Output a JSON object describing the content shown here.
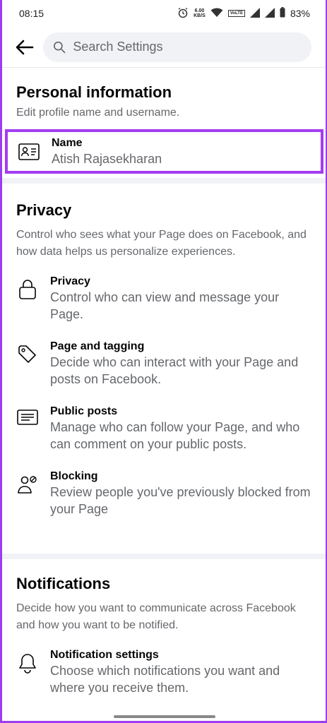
{
  "status_bar": {
    "time": "08:15",
    "net_speed_value": "6.00",
    "net_speed_unit": "KB/S",
    "volte": "VoLTE",
    "battery": "83%"
  },
  "header": {
    "search_placeholder": "Search Settings"
  },
  "personal": {
    "title": "Personal information",
    "desc": "Edit profile name and username.",
    "name_label": "Name",
    "name_value": "Atish Rajasekharan"
  },
  "privacy": {
    "title": "Privacy",
    "desc": "Control who sees what your Page does on Facebook, and how data helps us personalize experiences.",
    "items": [
      {
        "title": "Privacy",
        "desc": "Control who can view and message your Page.",
        "icon": "lock-icon"
      },
      {
        "title": "Page and tagging",
        "desc": "Decide who can interact with your Page and posts on Facebook.",
        "icon": "tag-icon"
      },
      {
        "title": "Public posts",
        "desc": "Manage who can follow your Page, and who can comment on your public posts.",
        "icon": "post-icon"
      },
      {
        "title": "Blocking",
        "desc": "Review people you've previously blocked from your Page",
        "icon": "block-user-icon"
      }
    ]
  },
  "notifications": {
    "title": "Notifications",
    "desc": "Decide how you want to communicate across Facebook and how you want to be notified.",
    "items": [
      {
        "title": "Notification settings",
        "desc": "Choose which notifications you want and where you receive them.",
        "icon": "bell-icon"
      }
    ]
  },
  "colors": {
    "highlight": "#a43cf2",
    "secondary_text": "#65676b",
    "search_bg": "#f0f2f5"
  }
}
